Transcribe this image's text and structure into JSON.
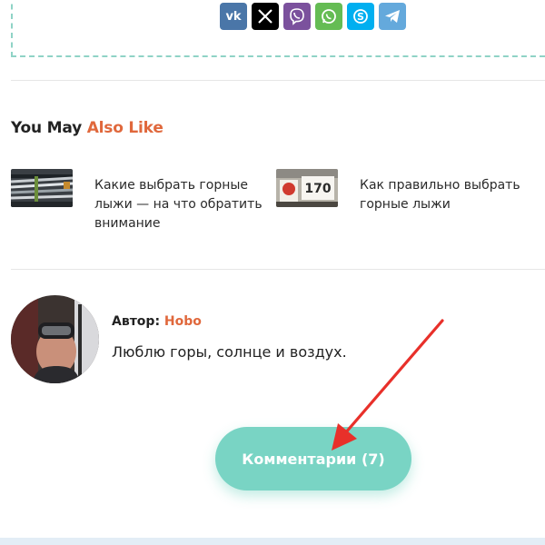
{
  "share": {
    "buttons": [
      {
        "name": "vk",
        "glyph": "vk",
        "color": "#4a76a8"
      },
      {
        "name": "x",
        "glyph": "",
        "color": "#000000"
      },
      {
        "name": "viber",
        "glyph": "",
        "color": "#7b519d"
      },
      {
        "name": "whatsapp",
        "glyph": "",
        "color": "#65bc54"
      },
      {
        "name": "skype",
        "glyph": "",
        "color": "#00aff0"
      },
      {
        "name": "telegram",
        "glyph": "",
        "color": "#64a9dc"
      }
    ]
  },
  "related": {
    "title_part1": "You May ",
    "title_part2": "Also Like",
    "items": [
      {
        "text": "Какие выбрать горные лыжи — на что обратить внимание",
        "thumb_icon": "skis-thumbnail"
      },
      {
        "text": "Как правильно выбрать горные лыжи",
        "thumb_icon": "ski-shop-thumbnail"
      }
    ],
    "thumb_badge": "170"
  },
  "author": {
    "label": "Автор: ",
    "name": "Hobo",
    "bio": "Люблю горы, солнце и воздух."
  },
  "comments": {
    "button_label": "Комментарии (7)"
  },
  "colors": {
    "accent": "#e0683c",
    "teal": "#79d4c4",
    "arrow": "#e8302a"
  }
}
